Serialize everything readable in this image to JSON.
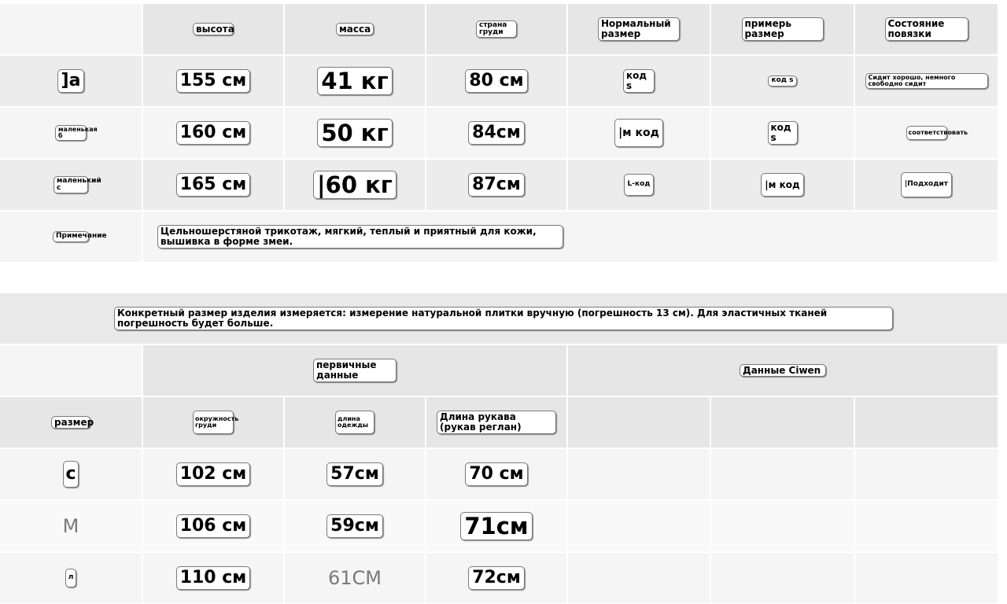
{
  "table1": {
    "headers": [
      "высота",
      "масса",
      "страна груди",
      "Нормальный размер",
      "примерь размер",
      "Состояние повязки"
    ],
    "rows": [
      {
        "label": "]a",
        "height": "155 см",
        "weight": "41 кг",
        "chest": "80 см",
        "normal": "код s",
        "tried": "код s",
        "state": "Сидит хорошо, немного свободно сидит"
      },
      {
        "label": "маленькая б",
        "height": "160 см",
        "weight": "50 кг",
        "chest": "84см",
        "normal": "|м код",
        "tried": "код s",
        "state": "соответствовать"
      },
      {
        "label": "маленький с",
        "height": "165 см",
        "weight": "|60 кг",
        "chest": "87см",
        "normal": "L-код",
        "tried": "|м код",
        "state": "|Подходит"
      }
    ],
    "note_label": "Примечание",
    "note_text": "Цельношерстяной трикотаж, мягкий, теплый и приятный для кожи, вышивка в форме змеи."
  },
  "measurement_note": "Конкретный размер изделия измеряется: измерение натуральной плитки вручную (погрешность 13 см). Для эластичных тканей погрешность будет больше.",
  "table2": {
    "group_primary": "первичные данные",
    "group_ciwen": "Данные Ciwen",
    "headers": [
      "размер",
      "окружность груди",
      "длина одежды",
      "Длина рукава (рукав реглан)"
    ],
    "rows": [
      {
        "size": "с",
        "chest": "102 см",
        "length": "57см",
        "sleeve": "70 см"
      },
      {
        "size": "M",
        "chest": "106 см",
        "length": "59см",
        "sleeve": "71см"
      },
      {
        "size": "л",
        "chest": "110 см",
        "length": "61CM",
        "sleeve": "72см"
      }
    ]
  }
}
